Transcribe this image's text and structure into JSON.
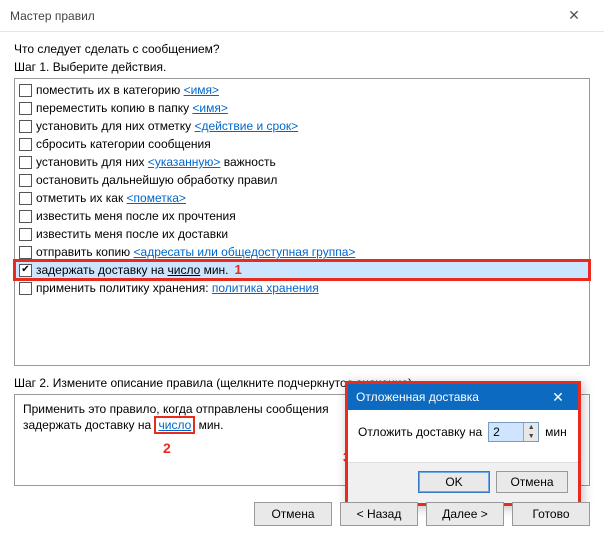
{
  "window": {
    "title": "Мастер правил"
  },
  "prompt": "Что следует сделать с сообщением?",
  "step1": {
    "label": "Шаг 1. Выберите действия.",
    "items": [
      {
        "checked": false,
        "pre": "поместить их в категорию ",
        "link": "<имя>",
        "post": ""
      },
      {
        "checked": false,
        "pre": "переместить копию в папку ",
        "link": "<имя>",
        "post": ""
      },
      {
        "checked": false,
        "pre": "установить для них отметку ",
        "link": "<действие и срок>",
        "post": ""
      },
      {
        "checked": false,
        "pre": "сбросить категории сообщения",
        "link": "",
        "post": ""
      },
      {
        "checked": false,
        "pre": "установить для них ",
        "link": "<указанную>",
        "post": " важность"
      },
      {
        "checked": false,
        "pre": "остановить дальнейшую обработку правил",
        "link": "",
        "post": ""
      },
      {
        "checked": false,
        "pre": "отметить их как ",
        "link": "<пометка>",
        "post": ""
      },
      {
        "checked": false,
        "pre": "известить меня после их прочтения",
        "link": "",
        "post": ""
      },
      {
        "checked": false,
        "pre": "известить меня после их доставки",
        "link": "",
        "post": ""
      },
      {
        "checked": false,
        "pre": "отправить копию ",
        "link": "<адресаты или общедоступная группа>",
        "post": ""
      },
      {
        "checked": true,
        "pre": "задержать доставку на ",
        "under": "число",
        "post2": " мин.",
        "marker": "1",
        "highlight": true
      },
      {
        "checked": false,
        "pre": "применить политику хранения: ",
        "link": "политика хранения",
        "post": ""
      }
    ]
  },
  "step2": {
    "label": "Шаг 2. Измените описание правила (щелкните подчеркнутое значение).",
    "line1": "Применить это правило, когда отправлены сообщения",
    "line2_pre": "задержать доставку на ",
    "line2_link": "число",
    "line2_post": " мин.",
    "marker2": "2",
    "marker3": "3"
  },
  "popup": {
    "title": "Отложенная доставка",
    "label_pre": "Отложить доставку на",
    "value": "2",
    "label_post": "мин",
    "ok": "OK",
    "cancel": "Отмена"
  },
  "footer": {
    "cancel": "Отмена",
    "back": "< Назад",
    "next": "Далее >",
    "finish": "Готово"
  }
}
